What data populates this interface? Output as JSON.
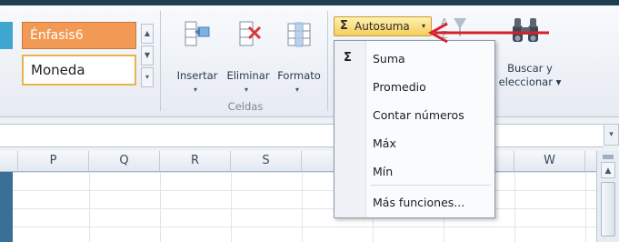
{
  "ribbon": {
    "styles": {
      "accent_style": "Énfasis6",
      "currency_style": "Moneda"
    },
    "cells_group": {
      "label": "Celdas",
      "insert_label": "Insertar",
      "delete_label": "Eliminar",
      "format_label": "Formato"
    },
    "editing_group": {
      "autosum_label": "Autosuma",
      "find_label_line1": "Buscar y",
      "find_label_line2": "eleccionar ▾"
    }
  },
  "autosum_menu": {
    "items": [
      {
        "label": "Suma",
        "icon": "sigma-icon"
      },
      {
        "label": "Promedio"
      },
      {
        "label": "Contar números"
      },
      {
        "label": "Máx"
      },
      {
        "label": "Mín"
      },
      {
        "label": "Más funciones..."
      }
    ]
  },
  "grid": {
    "columns": [
      "P",
      "Q",
      "R",
      "S",
      "",
      "",
      "",
      "W"
    ]
  },
  "colors": {
    "accent_style_fill": "#f29a55",
    "autosum_highlight": "#f6cd5b",
    "annotation_arrow": "#d8202a"
  }
}
